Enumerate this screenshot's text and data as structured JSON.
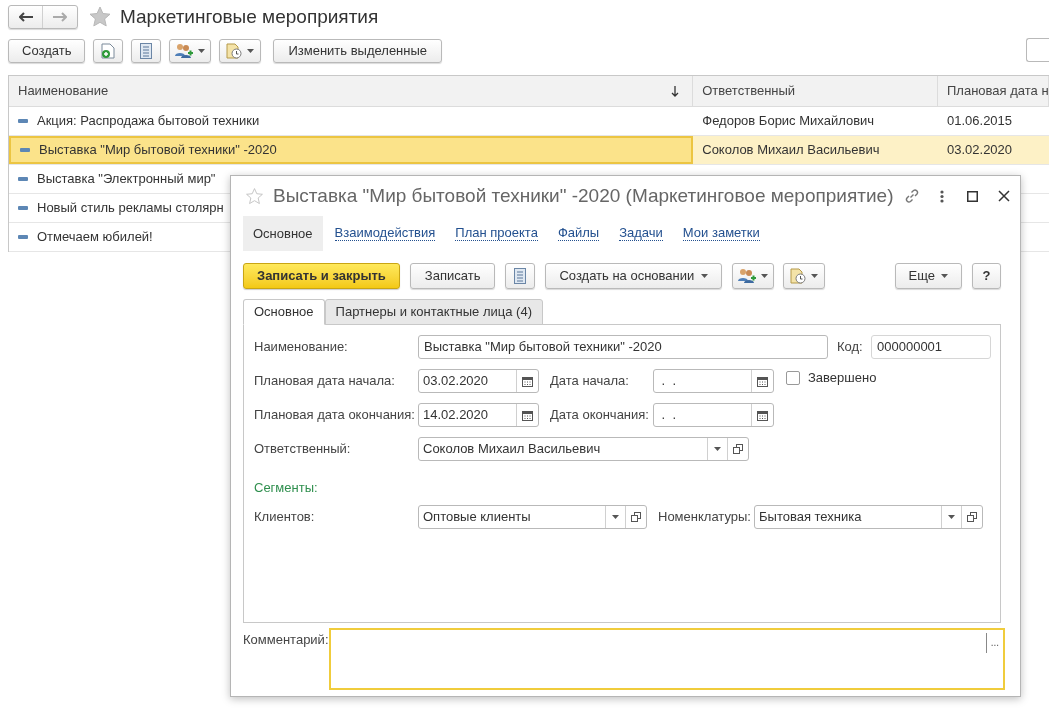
{
  "page": {
    "title": "Маркетинговые мероприятия",
    "starred": false
  },
  "toolbar": {
    "create": "Создать",
    "edit_selected": "Изменить выделенные"
  },
  "table": {
    "columns": [
      {
        "label": "Наименование",
        "sorted": true
      },
      {
        "label": "Ответственный"
      },
      {
        "label": "Плановая дата н"
      }
    ],
    "rows": [
      {
        "selected": false,
        "cells": [
          "Акция: Распродажа бытовой техники",
          "Федоров Борис Михайлович",
          "01.06.2015"
        ]
      },
      {
        "selected": true,
        "cells": [
          "Выставка \"Мир бытовой техники\" -2020",
          "Соколов Михаил Васильевич",
          "03.02.2020"
        ]
      },
      {
        "selected": false,
        "cells": [
          "Выставка \"Электронный мир\""
        ]
      },
      {
        "selected": false,
        "cells": [
          "Новый стиль рекламы столярн"
        ]
      },
      {
        "selected": false,
        "cells": [
          "Отмечаем юбилей!"
        ]
      }
    ]
  },
  "dialog": {
    "title": "Выставка \"Мир бытовой техники\" -2020 (Маркетинговое мероприятие)",
    "starred": false,
    "sections": [
      {
        "label": "Основное",
        "selected": true
      },
      {
        "label": "Взаимодействия",
        "selected": false
      },
      {
        "label": "План проекта",
        "selected": false
      },
      {
        "label": "Файлы",
        "selected": false
      },
      {
        "label": "Задачи",
        "selected": false
      },
      {
        "label": "Мои заметки",
        "selected": false
      }
    ],
    "buttons": {
      "save_close": "Записать и закрыть",
      "save": "Записать",
      "create_based": "Создать на основании",
      "more": "Еще",
      "help": "?"
    },
    "tabs": [
      {
        "label": "Основное",
        "selected": true
      },
      {
        "label": "Партнеры и контактные лица (4)",
        "selected": false
      }
    ],
    "rows": [
      [
        {
          "kind": "text",
          "label": "Наименование:",
          "value": "Выставка \"Мир бытовой техники\" -2020"
        },
        {
          "kind": "code",
          "label": "Код:",
          "value": "000000001"
        }
      ],
      [
        {
          "kind": "date",
          "label": "Плановая дата начала:",
          "value": "03.02.2020"
        },
        {
          "kind": "date",
          "label": "Дата начала:",
          "value": " .  ."
        },
        {
          "kind": "checkbox",
          "label": "Завершено",
          "checked": false
        }
      ],
      [
        {
          "kind": "date",
          "label": "Плановая дата окончания:",
          "value": "14.02.2020"
        },
        {
          "kind": "date",
          "label": "Дата окончания:",
          "value": " .  ."
        }
      ],
      [
        {
          "kind": "select",
          "label": "Ответственный:",
          "value": "Соколов Михаил Васильевич"
        }
      ],
      [
        {
          "kind": "heading",
          "label": "Сегменты:"
        }
      ],
      [
        {
          "kind": "select",
          "label": "Клиентов:",
          "value": "Оптовые клиенты"
        },
        {
          "kind": "select",
          "label": "Номенклатуры:",
          "value": "Бытовая техника"
        }
      ]
    ],
    "comment": {
      "label": "Комментарий:",
      "ellipsis": "..."
    }
  }
}
